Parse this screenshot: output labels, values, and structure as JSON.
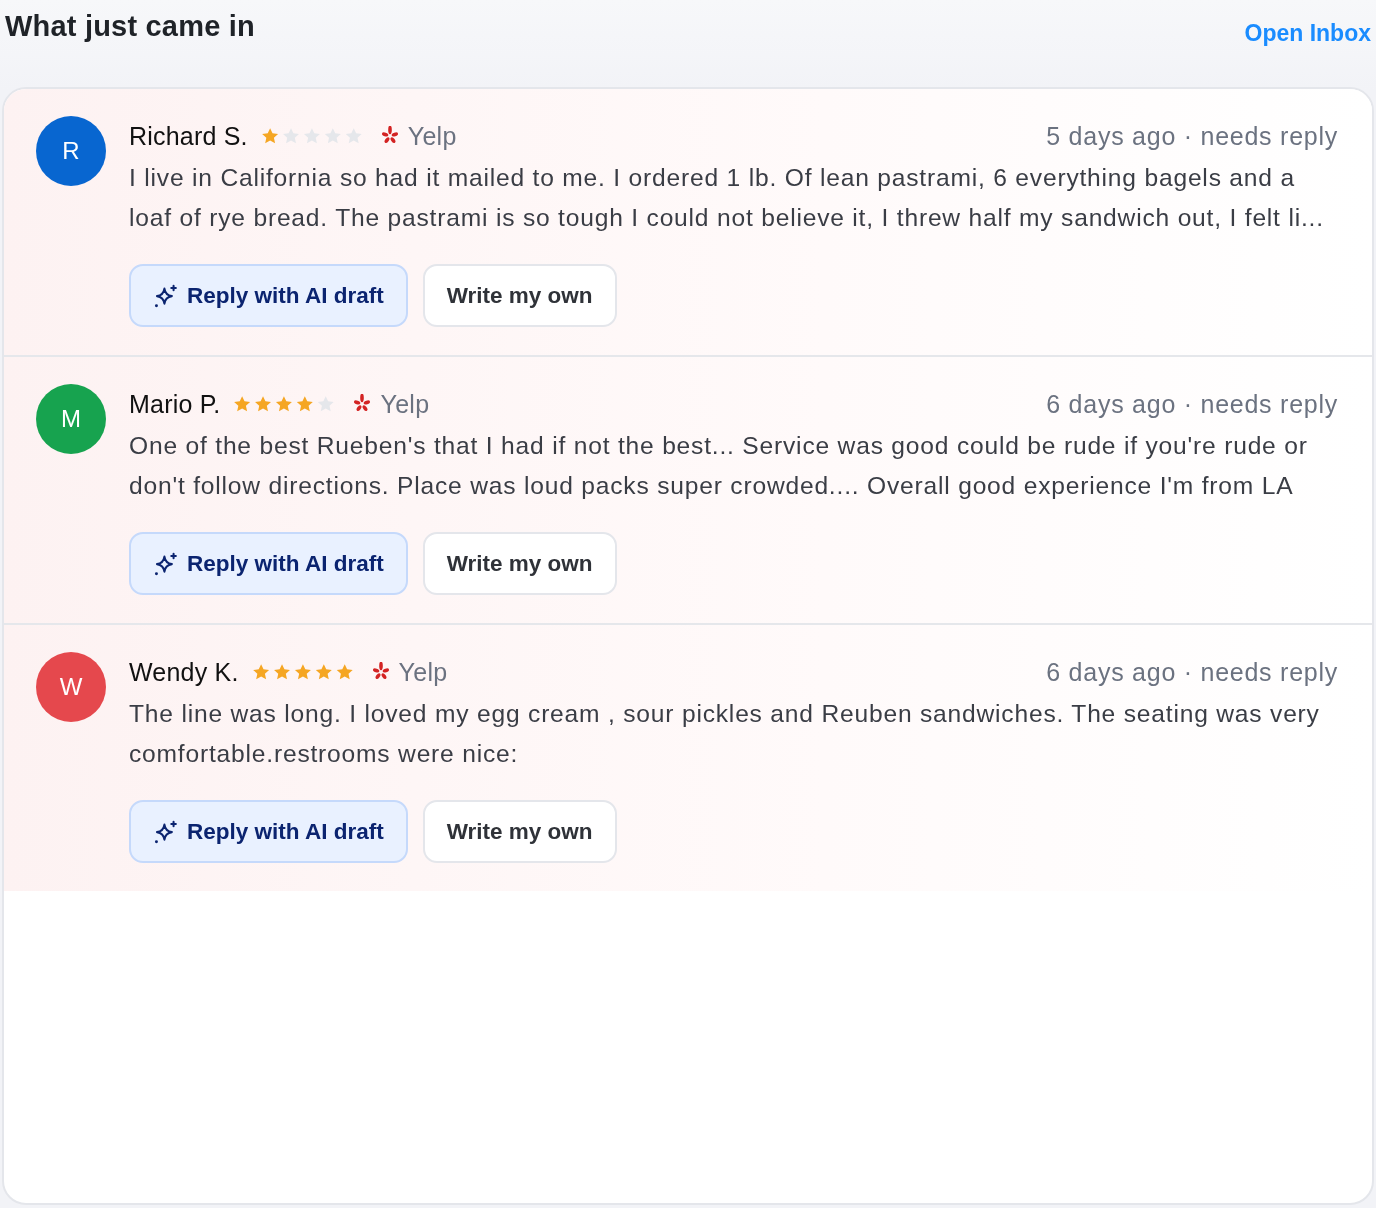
{
  "header": {
    "title": "What just came in",
    "link": "Open Inbox"
  },
  "reviews": [
    {
      "avatar": {
        "initial": "R",
        "color": "#0866d0"
      },
      "name": "Richard S.",
      "stars": 1,
      "source": "Yelp",
      "meta": "5 days ago · needs reply",
      "text": "I live in California so had it mailed to me. I ordered 1 lb. Of lean pastrami, 6 everything bagels and a loaf of rye bread. The pastrami is so tough I could not believe it, I threw half my sandwich out, I felt li...",
      "actions": [
        {
          "label": "Reply with AI draft",
          "kind": "ai"
        },
        {
          "label": "Write my own",
          "kind": "plain"
        }
      ]
    },
    {
      "avatar": {
        "initial": "M",
        "color": "#17a34f"
      },
      "name": "Mario P.",
      "stars": 4,
      "source": "Yelp",
      "meta": "6 days ago · needs reply",
      "text": "One of the best Rueben's that I had if not the best... Service was good could be rude if you're rude or don't follow directions. Place was loud packs super crowded.... Overall good experience I'm from LA",
      "actions": [
        {
          "label": "Reply with AI draft",
          "kind": "ai"
        },
        {
          "label": "Write my own",
          "kind": "plain"
        }
      ]
    },
    {
      "avatar": {
        "initial": "W",
        "color": "#e5484d"
      },
      "name": "Wendy K.",
      "stars": 5,
      "source": "Yelp",
      "meta": "6 days ago · needs reply",
      "text": "The line was long. I loved my egg cream , sour pickles and Reuben sandwiches. The seating was very comfortable.restrooms were nice:",
      "actions": [
        {
          "label": "Reply with AI draft",
          "kind": "ai"
        },
        {
          "label": "Write my own",
          "kind": "plain"
        }
      ]
    }
  ]
}
